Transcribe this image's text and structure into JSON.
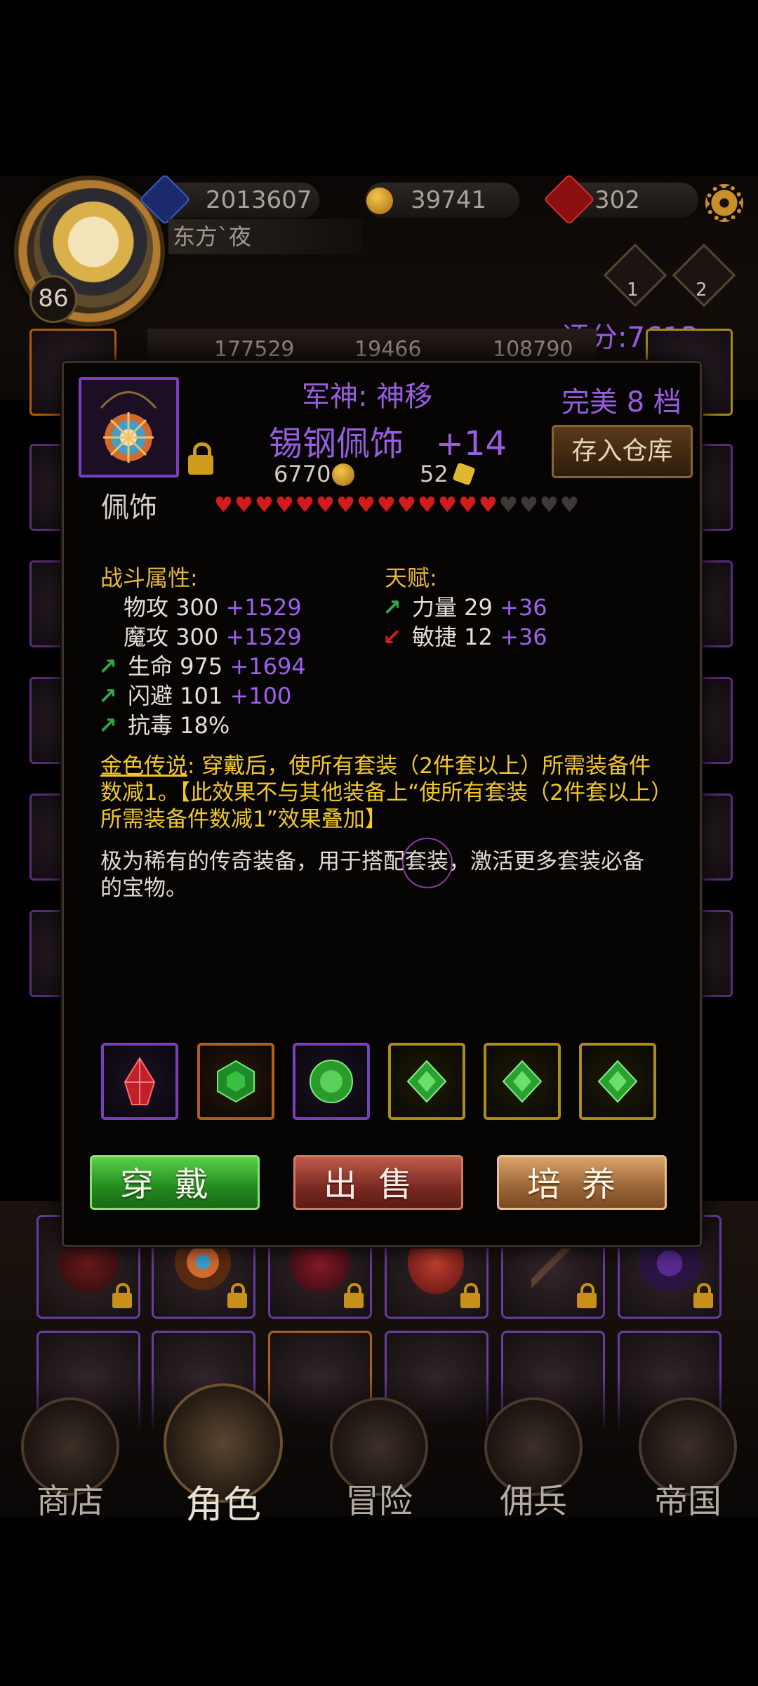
{
  "header": {
    "level": "86",
    "player_name": "东方`夜",
    "resources": [
      "2013607",
      "39741",
      "302"
    ],
    "rank_badges": [
      "1",
      "2"
    ],
    "score": "评分:7613",
    "stats": [
      "177529",
      "19466",
      "108790"
    ]
  },
  "dialog": {
    "set_name": "军神: 神移",
    "item_name": "锡钢佩饰   +14",
    "quality": "完美 8 档",
    "store_button": "存入仓库",
    "price_gold": "6770",
    "price_pieces": "52",
    "slot_type": "佩饰",
    "stars_filled": 14,
    "stars_total": 18,
    "combat_title": "战斗属性:",
    "combat_attrs": [
      {
        "base": "物攻 300 ",
        "bonus": "+1529",
        "arrow": ""
      },
      {
        "base": "魔攻 300 ",
        "bonus": "+1529",
        "arrow": ""
      },
      {
        "base": "生命 975 ",
        "bonus": "+1694",
        "arrow": "up"
      },
      {
        "base": "闪避 101 ",
        "bonus": "+100",
        "arrow": "up"
      },
      {
        "base": "抗毒 18%",
        "bonus": "",
        "arrow": "up"
      }
    ],
    "talent_title": "天赋:",
    "talent_attrs": [
      {
        "base": "力量 29 ",
        "bonus": "+36",
        "arrow": "up"
      },
      {
        "base": "敏捷 12 ",
        "bonus": "+36",
        "arrow": "down"
      }
    ],
    "legend_head": "金色传说",
    "legend_text": ": 穿戴后，使所有套装（2件套以上）所需装备件数减1。【此效果不与其他装备上“使所有套装（2件套以上）所需装备件数减1”效果叠加】",
    "description": "极为稀有的传奇装备，用于搭配套装，激活更多套装必备的宝物。",
    "buttons": {
      "equip": "穿戴",
      "sell": "出售",
      "train": "培养"
    }
  },
  "nav": [
    "商店",
    "角色",
    "冒险",
    "佣兵",
    "帝国"
  ],
  "colors": {
    "purple_text": "#9a5ce0",
    "gold_text": "#f0c828",
    "bonus": "#a060f0"
  },
  "icons": [
    "gear-icon",
    "lock-icon",
    "coin-icon",
    "puzzle-piece-icon",
    "heart-icon"
  ]
}
